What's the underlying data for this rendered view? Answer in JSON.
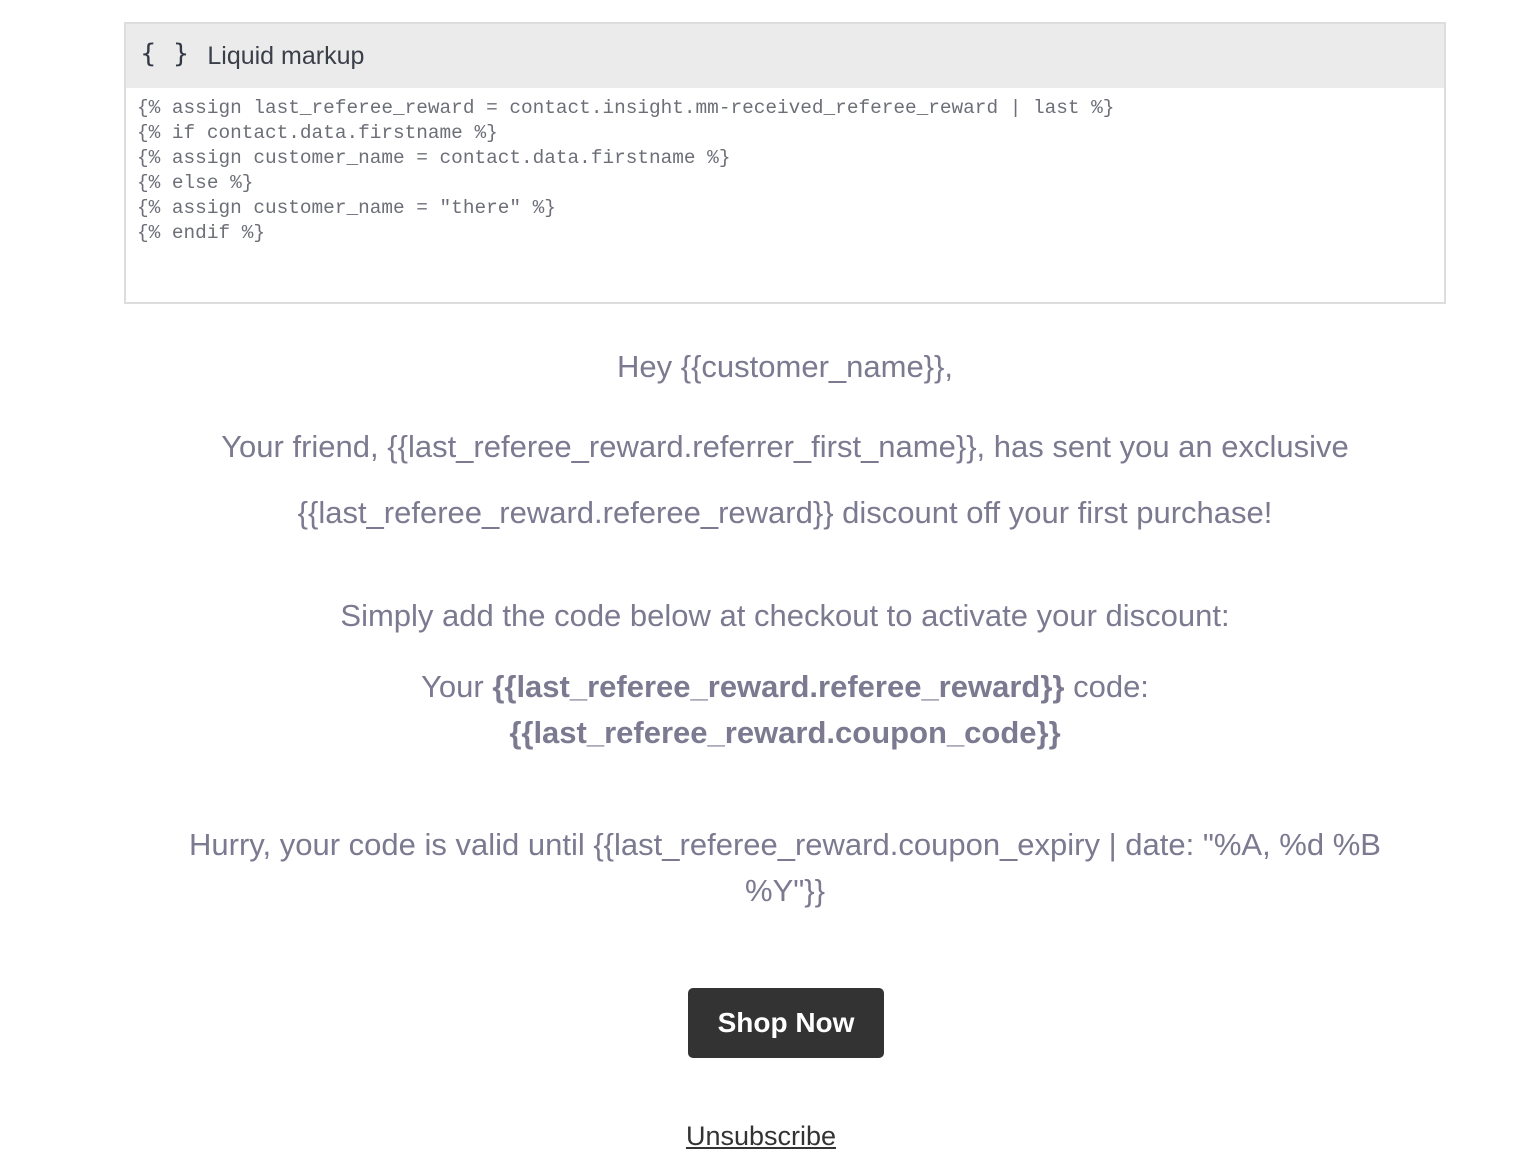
{
  "liquid_block": {
    "icon": "braces-icon",
    "title": "Liquid markup",
    "code": "{% assign last_referee_reward = contact.insight.mm-received_referee_reward | last %}\n{% if contact.data.firstname %}\n{% assign customer_name = contact.data.firstname %}\n{% else %}\n{% assign customer_name = \"there\" %}\n{% endif %}"
  },
  "email": {
    "greeting": "Hey {{customer_name}},",
    "intro": "Your friend, {{last_referee_reward.referrer_first_name}}, has sent you an exclusive {{last_referee_reward.referee_reward}} discount off your first purchase!",
    "instructions": "Simply add the code below at checkout to activate your discount:",
    "code_prefix": "Your ",
    "code_reward": "{{last_referee_reward.referee_reward}}",
    "code_suffix": " code:",
    "coupon_code": "{{last_referee_reward.coupon_code}}",
    "expiry": "Hurry, your code is valid until {{last_referee_reward.coupon_expiry | date: \"%A, %d %B %Y\"}}",
    "shop_button_label": "Shop Now",
    "unsubscribe_label": "Unsubscribe"
  },
  "colors": {
    "body_text": "#7b7a90",
    "button_bg": "#333333",
    "header_bg": "#eaebea"
  }
}
